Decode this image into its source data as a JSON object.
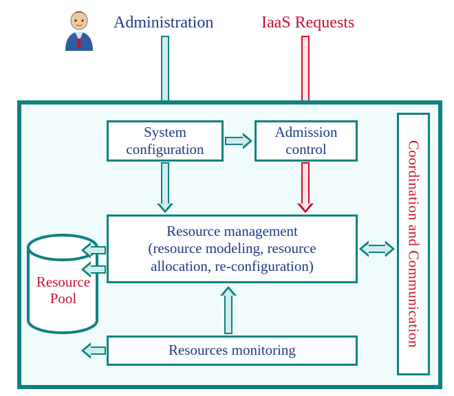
{
  "labels": {
    "administration": "Administration",
    "iaas_requests": "IaaS Requests",
    "system_configuration": "System\nconfiguration",
    "admission_control": "Admission\ncontrol",
    "resource_management": "Resource management\n(resource modeling, resource\nallocation, re-configuration)",
    "resources_monitoring": "Resources monitoring",
    "coordination": "Coordination and Communication",
    "resource_pool_1": "Resource",
    "resource_pool_2": "Pool"
  },
  "colors": {
    "teal": "#108181",
    "blue_text": "#1f3a84",
    "red": "#c8102e",
    "inner_fill": "#cdeeee"
  },
  "diagram": {
    "type": "block-architecture",
    "external_inputs": [
      "Administration",
      "IaaS Requests"
    ],
    "components": [
      "System configuration",
      "Admission control",
      "Resource management",
      "Resources monitoring",
      "Coordination and Communication",
      "Resource Pool"
    ],
    "flows": [
      {
        "from": "Administration",
        "to": "System configuration",
        "style": "teal"
      },
      {
        "from": "IaaS Requests",
        "to": "Admission control",
        "style": "red"
      },
      {
        "from": "System configuration",
        "to": "Admission control",
        "style": "teal"
      },
      {
        "from": "System configuration",
        "to": "Resource management",
        "style": "teal"
      },
      {
        "from": "Admission control",
        "to": "Resource management",
        "style": "red"
      },
      {
        "from": "Resource management",
        "to": "Resource Pool",
        "style": "teal-bidir"
      },
      {
        "from": "Resources monitoring",
        "to": "Resource management",
        "style": "teal"
      },
      {
        "from": "Resources monitoring",
        "to": "Resource Pool",
        "style": "teal"
      },
      {
        "from": "Resource management",
        "to": "Coordination and Communication",
        "style": "teal-bidir"
      }
    ]
  }
}
